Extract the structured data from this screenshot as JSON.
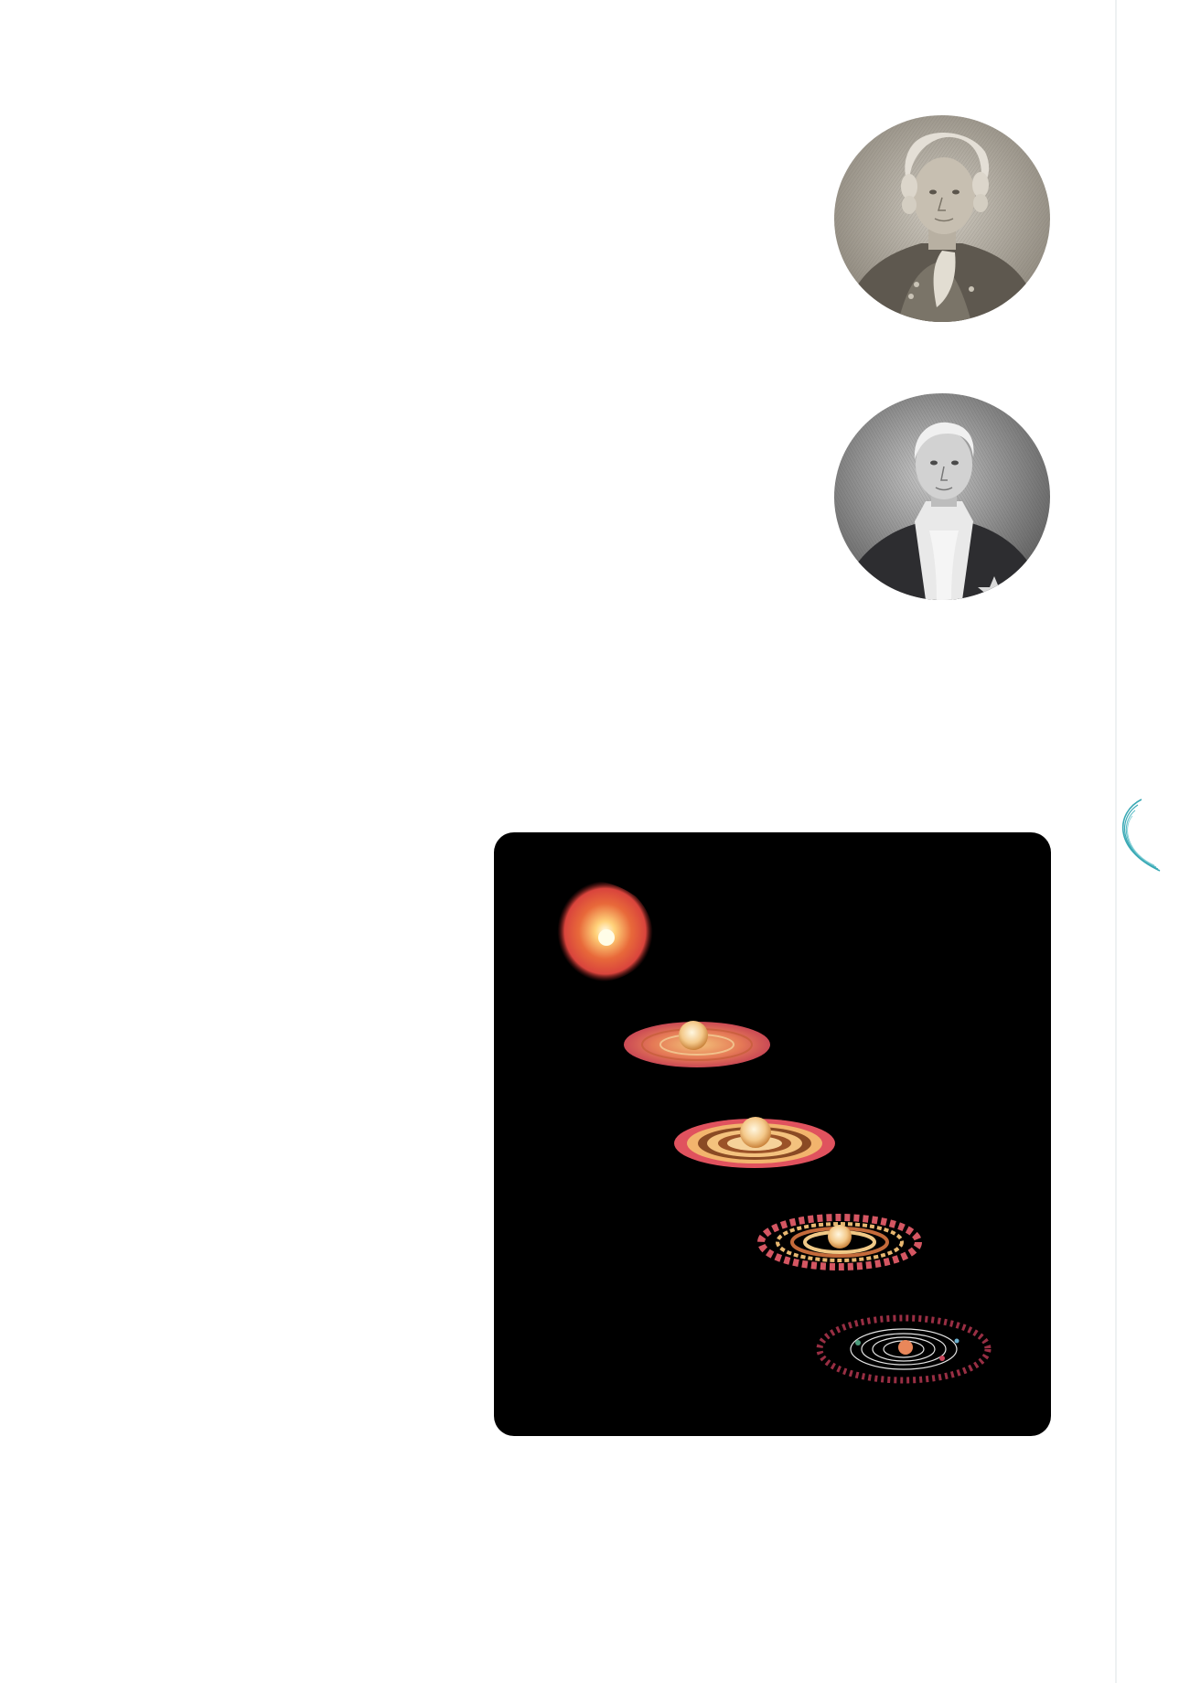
{
  "page": {
    "background": "#ffffff",
    "margin_rule_color": "#eef1f2",
    "accent": "#3aa9b5"
  },
  "figures": {
    "portrait_1": {
      "icon": "engraved-portrait-powdered-wig"
    },
    "portrait_2": {
      "icon": "engraved-portrait-high-collar"
    },
    "margin_mark": {
      "icon": "teal-crescent-swirl-icon"
    },
    "nebular_sequence": {
      "background": "#000000",
      "stages": [
        "collapsing-cloud",
        "flattening-disk",
        "ringed-disk",
        "beaded-rings",
        "planetary-system"
      ]
    }
  }
}
